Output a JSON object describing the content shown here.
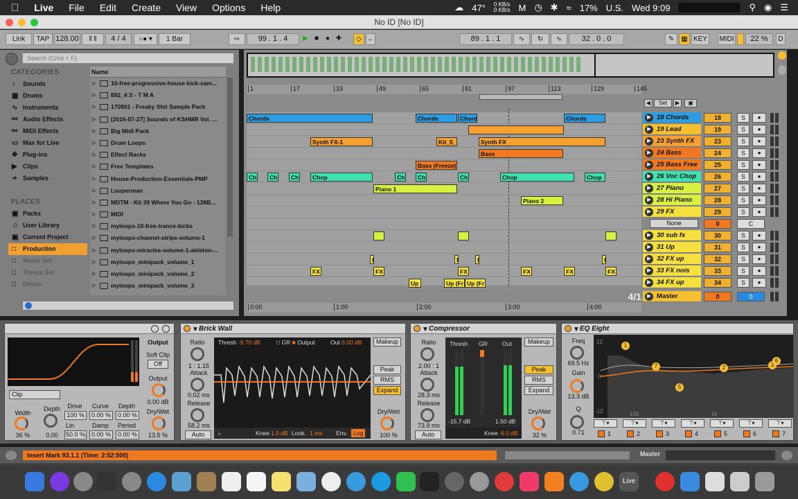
{
  "menubar": {
    "app": "Live",
    "items": [
      "File",
      "Edit",
      "Create",
      "View",
      "Options",
      "Help"
    ],
    "temp": "47°",
    "net_up": "0 KB/s",
    "net_down": "0 KB/s",
    "battery": "17%",
    "input": "U.S.",
    "clock": "Wed 9:09"
  },
  "window": {
    "title": "No ID  [No ID]"
  },
  "transport": {
    "link": "Link",
    "tap": "TAP",
    "tempo": "128.00",
    "sig": "4 / 4",
    "quant": "1 Bar",
    "position": "99 .  1 .  4",
    "loop_start": "89 .  1 .  1",
    "loop_len": "32 .  0 .  0",
    "key": "KEY",
    "midi": "MIDI",
    "cpu": "22 %",
    "d": "D"
  },
  "browser": {
    "search_placeholder": "Search (Cmd + F)",
    "categories_label": "CATEGORIES",
    "categories": [
      "Sounds",
      "Drums",
      "Instruments",
      "Audio Effects",
      "MIDI Effects",
      "Max for Live",
      "Plug-ins",
      "Clips",
      "Samples"
    ],
    "places_label": "PLACES",
    "places": [
      "Packs",
      "User Library",
      "Current Project",
      "Production",
      "Music Set",
      "Trance Set",
      "Dinner"
    ],
    "name_header": "Name",
    "files": [
      "10-free-progressive-house-kick-sam...",
      "892_4 S - T M A",
      "170901 - Freaky Shit Sample Pack",
      "[2016-07-27] Sounds of KSHMR Vol. ...",
      "Big Midi Pack",
      "Drum Loops",
      "Effect Racks",
      "Free Templates",
      "House-Production-Essentials-PMP",
      "Looperman",
      "MDTM - Kit 39 Where You Go - 138B...",
      "MIDI",
      "myloops-10-free-trance-kicks",
      "myloops-channel-strips-volume-1",
      "myloops-miracles-volume-1-ableton-...",
      "myloops_minipack_volume_1",
      "myloops_minipack_volume_2",
      "myloops_minipack_volume_3"
    ]
  },
  "ruler": [
    "1",
    "17",
    "33",
    "49",
    "65",
    "81",
    "97",
    "113",
    "129",
    "145"
  ],
  "timeline": [
    "0:00",
    "1:00",
    "2:00",
    "3:00",
    "4:00"
  ],
  "set_label": "Set",
  "sig_display": "4/1",
  "tracks": [
    {
      "name": "18 Chords",
      "num": "18",
      "color": "#2e9ce0"
    },
    {
      "name": "19 Lead",
      "num": "19",
      "color": "#f5c030"
    },
    {
      "name": "23 Synth FX",
      "num": "23",
      "color": "#f5a030"
    },
    {
      "name": "24 Bass",
      "num": "24",
      "color": "#f07820"
    },
    {
      "name": "25 Bass Free",
      "num": "25",
      "color": "#f07820"
    },
    {
      "name": "26 Voc Chop",
      "num": "26",
      "color": "#40e0b0"
    },
    {
      "name": "27 Piano",
      "num": "27",
      "color": "#d8f040"
    },
    {
      "name": "28 Hi Piano",
      "num": "28",
      "color": "#d8f040"
    },
    {
      "name": "29 FX",
      "num": "29",
      "color": "#f5e040"
    },
    {
      "name": "",
      "num": "0",
      "color": "#f5e040"
    },
    {
      "name": "30 sub fx",
      "num": "30",
      "color": "#f5e040"
    },
    {
      "name": "31 Up",
      "num": "31",
      "color": "#f5e040"
    },
    {
      "name": "32 FX up",
      "num": "32",
      "color": "#f5e040"
    },
    {
      "name": "33 FX nois",
      "num": "33",
      "color": "#f5e040"
    },
    {
      "name": "34 FX up",
      "num": "34",
      "color": "#f5e040"
    }
  ],
  "fx_none": "None",
  "fx_c": "C",
  "master": {
    "name": "Master",
    "vol": "0",
    "pan": "0"
  },
  "clips": {
    "chords": "Chords",
    "chord": "Chord",
    "synthfx1": "Synth FX-1",
    "kit": "Kit_5_",
    "synthfx": "Synth FX",
    "bass": "Bass",
    "bassfreeze": "Bass (Freeze)",
    "chop": "Chop",
    "ch": "Ch",
    "piano1": "Piano 1",
    "piano2": "Piano 2",
    "fx": "FX",
    "up": "Up",
    "upfr": "Up (Fr",
    "l": "L"
  },
  "devices": {
    "saturator": {
      "output_label": "Output",
      "softclip": "Soft Clip",
      "off": "Off",
      "output": "Output",
      "output_val": "0.00 dB",
      "drywet": "Dry/Wet",
      "drywet_val": "13.5 %",
      "clip": "Clip",
      "width": "Width",
      "width_val": "36 %",
      "depth": "Depth",
      "depth_val": "0.00",
      "drive": "Drive",
      "drive_val": "100 %",
      "curve": "Curve",
      "curve_val": "0.00 %",
      "depth2": "Depth",
      "depth2_val": "0.00 %",
      "lin": "Lin",
      "lin_val": "50.0 %",
      "damp": "Damp",
      "damp_val": "0.00 %",
      "period": "Period",
      "period_val": "0.00 %"
    },
    "brickwall": {
      "title": "Brick Wall",
      "ratio": "Ratio",
      "ratio_val": "1 : 1.15",
      "attack": "Attack",
      "attack_val": "0.02 ms",
      "release": "Release",
      "release_val": "58.2 ms",
      "auto": "Auto",
      "thresh": "Thresh",
      "thresh_val": "-9.70 dB",
      "gr": "GR",
      "output": "Output",
      "out": "Out",
      "out_val": "0.00 dB",
      "knee": "Knee",
      "knee_val": "1.0 dB",
      "look": "Look.",
      "look_val": "1 ms",
      "env": "Env.",
      "log": "Log",
      "makeup": "Makeup",
      "peak": "Peak",
      "rms": "RMS",
      "expand": "Expand",
      "drywet": "Dry/Wet",
      "drywet_val": "100 %"
    },
    "compressor": {
      "title": "Compressor",
      "ratio": "Ratio",
      "ratio_val": "2.00 : 1",
      "attack": "Attack",
      "attack_val": "28.3 ms",
      "release": "Release",
      "release_val": "73.9 ms",
      "auto": "Auto",
      "thresh": "Thresh",
      "gr": "GR",
      "out": "Out",
      "thresh_val": "-15.7 dB",
      "out_val": "1.50 dB",
      "knee": "Knee",
      "knee_val": "6.0 dB",
      "makeup": "Makeup",
      "peak": "Peak",
      "rms": "RMS",
      "expand": "Expand",
      "drywet": "Dry/Wet",
      "drywet_val": "32 %"
    },
    "eq": {
      "title": "EQ Eight",
      "freq": "Freq",
      "freq_val": "69.5 Hz",
      "gain": "Gain",
      "gain_val": "13.3 dB",
      "q": "Q",
      "q_val": "0.71",
      "db12": "12",
      "db0": "0",
      "dbm12": "-12",
      "f100": "100",
      "f1k": "1k",
      "bands": [
        "1",
        "2",
        "3",
        "4",
        "5",
        "6",
        "7"
      ]
    }
  },
  "status": {
    "message": "Insert Mark 93.1.1 (Time: 2:52:500)",
    "master": "Master"
  }
}
